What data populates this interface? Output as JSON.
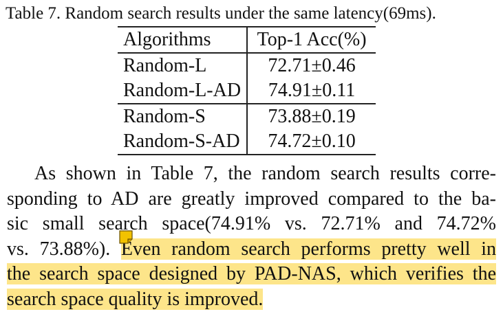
{
  "caption": "Table 7. Random search results under the same latency(69ms).",
  "table": {
    "headers": [
      "Algorithms",
      "Top-1 Acc(%)"
    ],
    "rows": [
      [
        "Random-L",
        "72.71±0.46"
      ],
      [
        "Random-L-AD",
        "74.91±0.11"
      ],
      [
        "Random-S",
        "73.88±0.19"
      ],
      [
        "Random-S-AD",
        "74.72±0.10"
      ]
    ]
  },
  "paragraph": {
    "line1": "As shown in Table 7, the random search results corre-",
    "line2": "sponding to AD are greatly improved compared to the ba-",
    "line3": "sic small search space(74.91% vs.  72.71% and 74.72%",
    "line4_plain": "vs. 73.88%). ",
    "line4_highlight": "Even random search performs pretty well in",
    "line5_highlight": "the search space designed by PAD-NAS, which verifies the",
    "line6_highlight": "search space quality is improved."
  },
  "highlight_color": "#fde58a",
  "note_icon_color": "#f2c200",
  "note_icon": "sticky-note-icon"
}
